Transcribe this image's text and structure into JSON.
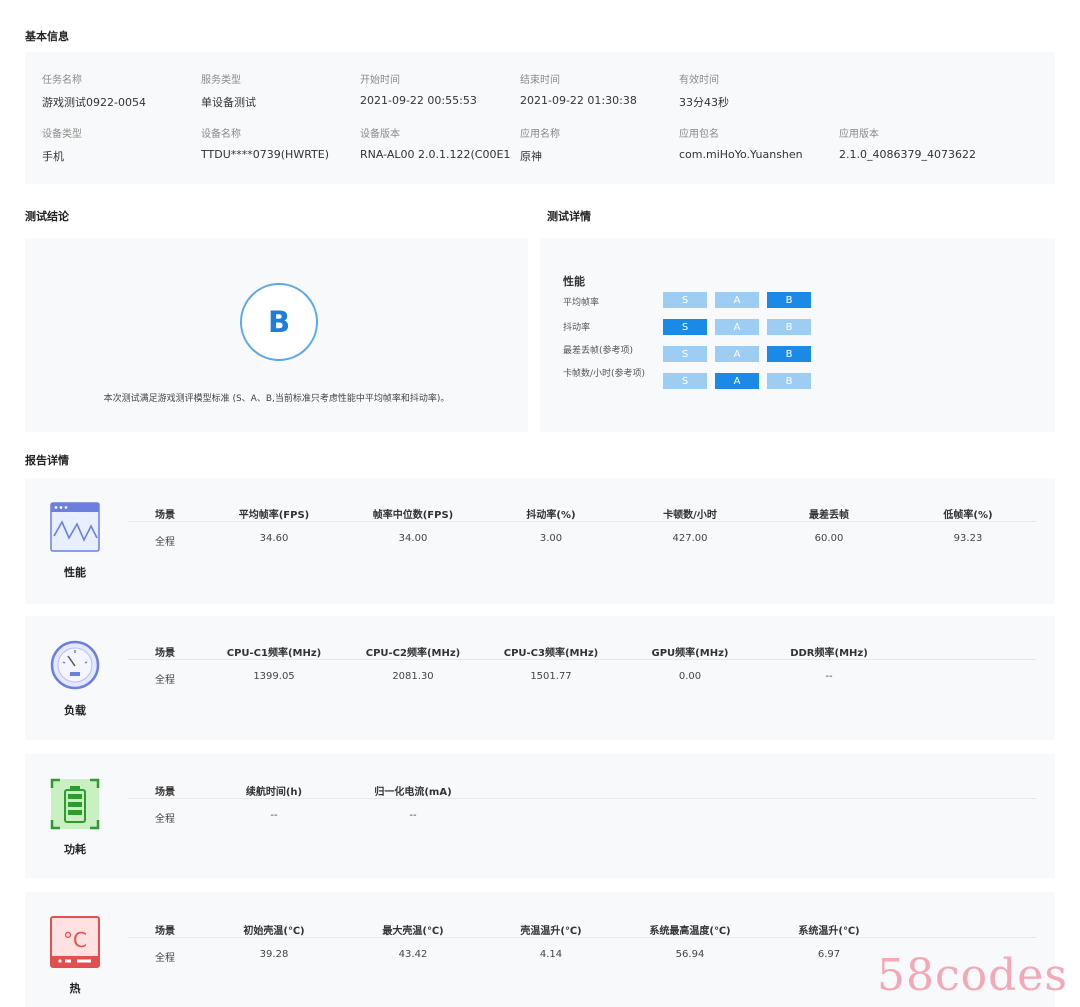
{
  "sections": {
    "basic_info": "基本信息",
    "test_conclusion": "测试结论",
    "test_details": "测试详情",
    "report_details": "报告详情"
  },
  "basic_info": {
    "row1": [
      {
        "label": "任务名称",
        "value": "游戏测试0922-0054"
      },
      {
        "label": "服务类型",
        "value": "单设备测试"
      },
      {
        "label": "开始时间",
        "value": "2021-09-22 00:55:53"
      },
      {
        "label": "结束时间",
        "value": "2021-09-22 01:30:38"
      },
      {
        "label": "有效时间",
        "value": "33分43秒"
      }
    ],
    "row2": [
      {
        "label": "设备类型",
        "value": "手机"
      },
      {
        "label": "设备名称",
        "value": "TTDU****0739(HWRTE)"
      },
      {
        "label": "设备版本",
        "value": "RNA-AL00 2.0.1.122(C00E1"
      },
      {
        "label": "应用名称",
        "value": "原神"
      },
      {
        "label": "应用包名",
        "value": "com.miHoYo.Yuanshen"
      },
      {
        "label": "应用版本",
        "value": "2.1.0_4086379_4073622"
      }
    ]
  },
  "conclusion": {
    "grade": "B",
    "note": "本次测试满足游戏测评模型标准 (S、A、B,当前标准只考虑性能中平均帧率和抖动率)。"
  },
  "details": {
    "heading": "性能",
    "grades": [
      "S",
      "A",
      "B"
    ],
    "metrics": [
      {
        "label": "平均帧率",
        "selected": "B"
      },
      {
        "label": "抖动率",
        "selected": "S"
      },
      {
        "label": "最差丢帧(参考项)",
        "selected": "B"
      },
      {
        "label": "卡帧数/小时(参考项)",
        "selected": "A"
      }
    ]
  },
  "report": {
    "performance": {
      "label": "性能",
      "headers": [
        "场景",
        "平均帧率(FPS)",
        "帧率中位数(FPS)",
        "抖动率(%)",
        "卡顿数/小时",
        "最差丢帧",
        "低帧率(%)"
      ],
      "row": [
        "全程",
        "34.60",
        "34.00",
        "3.00",
        "427.00",
        "60.00",
        "93.23"
      ]
    },
    "load": {
      "label": "负载",
      "headers": [
        "场景",
        "CPU-C1频率(MHz)",
        "CPU-C2频率(MHz)",
        "CPU-C3频率(MHz)",
        "GPU频率(MHz)",
        "DDR频率(MHz)"
      ],
      "row": [
        "全程",
        "1399.05",
        "2081.30",
        "1501.77",
        "0.00",
        "--"
      ]
    },
    "power": {
      "label": "功耗",
      "headers": [
        "场景",
        "续航时间(h)",
        "归一化电流(mA)"
      ],
      "row": [
        "全程",
        "--",
        "--"
      ]
    },
    "thermal": {
      "label": "热",
      "icon_text": "°C",
      "headers": [
        "场景",
        "初始壳温(℃)",
        "最大壳温(℃)",
        "壳温温升(℃)",
        "系统最高温度(℃)",
        "系统温升(℃)"
      ],
      "row": [
        "全程",
        "39.28",
        "43.42",
        "4.14",
        "56.94",
        "6.97"
      ]
    }
  },
  "watermark": "58codes",
  "colors": {
    "grade_selected": "#1a8ae6",
    "grade_unselected": "#9dcdf2",
    "circle_border": "#5aa9e6",
    "watermark": "#f2a8b7"
  }
}
